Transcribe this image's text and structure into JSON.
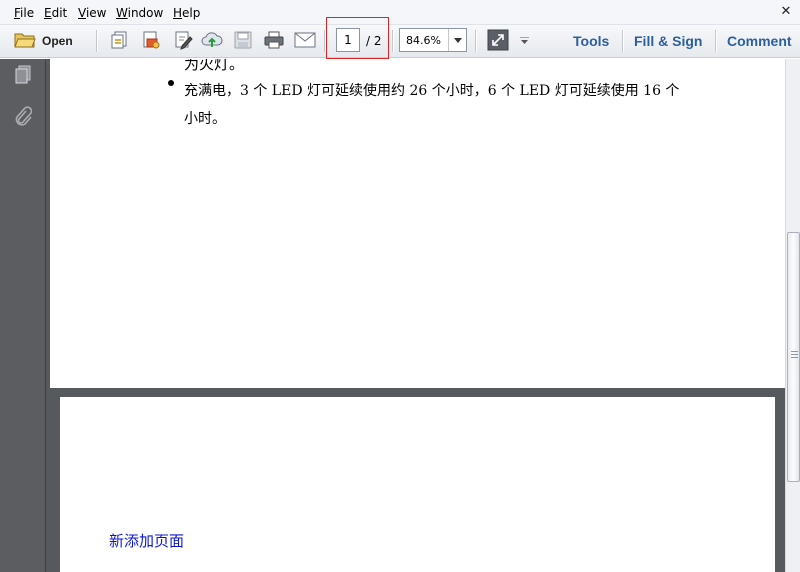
{
  "menu": {
    "file": {
      "acc": "F",
      "rest": "ile"
    },
    "edit": {
      "acc": "E",
      "rest": "dit"
    },
    "view": {
      "acc": "V",
      "rest": "iew"
    },
    "window": {
      "acc": "W",
      "rest": "indow"
    },
    "help": {
      "acc": "H",
      "rest": "elp"
    }
  },
  "window_controls": {
    "close": "✕"
  },
  "toolbar": {
    "open_label": "Open",
    "page_current": "1",
    "page_total": "/ 2",
    "zoom_value": "84.6%",
    "tools_label": "Tools",
    "fill_sign_label": "Fill & Sign",
    "comment_label": "Comment",
    "icons": [
      "folder-open-icon",
      "create-pdf-icon",
      "export-pdf-icon",
      "edit-pdf-icon",
      "upload-cloud-icon",
      "save-icon",
      "print-icon",
      "email-icon",
      "fit-page-icon",
      "more-tools-icon"
    ],
    "highlight_color": "#e02424"
  },
  "nav_pane": {
    "icons": [
      "page-thumbnails-icon",
      "attachments-icon"
    ]
  },
  "document": {
    "page1": {
      "cut_off_line": "为火灯。",
      "bullet_text": "充满电，3 个 LED 灯可延续使用约 26 个小时，6 个 LED 灯可延续使用 16 个小时。"
    },
    "page2": {
      "added_text": "新添加页面",
      "added_text_color": "#0b15d8"
    }
  }
}
